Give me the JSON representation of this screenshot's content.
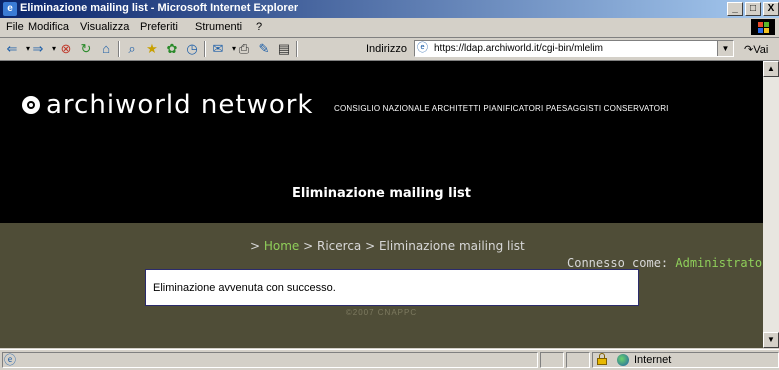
{
  "window": {
    "title": "Eliminazione mailing list - Microsoft Internet Explorer",
    "controls": [
      "_",
      "□",
      "X"
    ]
  },
  "menu": {
    "items": [
      "File",
      "Modifica",
      "Visualizza",
      "Preferiti",
      "Strumenti",
      "?"
    ]
  },
  "toolbar": {
    "address_label": "Indirizzo",
    "url": "https://ldap.archiworld.it/cgi-bin/mlelim",
    "go_label": "Vai"
  },
  "page": {
    "logo": "archiworld network",
    "org": "CONSIGLIO NAZIONALE ARCHITETTI PIANIFICATORI PAESAGGISTI CONSERVATORI",
    "title": "Eliminazione mailing list",
    "breadcrumb": {
      "prefix": "> ",
      "home": "Home",
      "rest": " > Ricerca > Eliminazione mailing list"
    },
    "connected": {
      "label": "Connesso come: ",
      "user": "Administrator"
    },
    "message": "Eliminazione avvenuta con successo.",
    "copyright": "©2007 CNAPPC"
  },
  "statusbar": {
    "zone": "Internet"
  },
  "colors": {
    "header_bg": "#000000",
    "content_bg": "#4f4d37",
    "link_green": "#8fcf5a",
    "titlebar": "#0a246a"
  }
}
